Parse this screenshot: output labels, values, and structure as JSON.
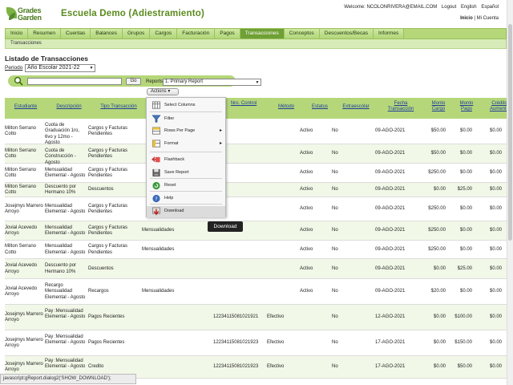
{
  "header": {
    "logo_top": "Grades",
    "logo_bottom": "Garden",
    "school": "Escuela Demo (Adiestramiento)",
    "welcome": "Welcome: NCOLONRIVERA@EMAIL.COM",
    "logout": "Logout",
    "english": "English",
    "espanol": "Español",
    "inicio": "Inicio",
    "sep": "|",
    "mi_cuenta": "Mi Cuenta"
  },
  "nav": {
    "tabs": [
      "Inicio",
      "Resumen",
      "Cuentas",
      "Balances",
      "Grupos",
      "Cargos",
      "Facturación",
      "Pagos",
      "Transacciones",
      "Conceptos",
      "Descuentos/Becas",
      "Informes"
    ],
    "active": 8,
    "sub": "Transacciones"
  },
  "page": {
    "title": "Listado de Transacciones",
    "periodo_label": "Periodo",
    "periodo_value": "Año Escolar 2021-22",
    "go": "Go",
    "reports_label": "Reports",
    "reports_value": "1. Primary Report",
    "actions": "Actions"
  },
  "table": {
    "headers": [
      "Estudiante",
      "Descripción",
      "Tipo Transacción",
      "Nro. Control",
      "Método",
      "Estatus",
      "Extraescolar",
      "Fecha Transacción",
      "Monto Cargo",
      "Monto Pago",
      "Crédito Aumento"
    ],
    "rows": [
      {
        "est": "Milton Serrano Cotto",
        "desc": "Cuota de Graduación 1ro, 6vo y 12mo - Agosto",
        "tipo": "Cargos y Facturas Pendientes",
        "cat": "",
        "ctrl": "",
        "met": "",
        "estat": "Activo",
        "extra": "No",
        "fecha": "09-AGO-2021",
        "cargo": "$50.00",
        "pago": "$0.00",
        "cred": "$0.00"
      },
      {
        "est": "Milton Serrano Cotto",
        "desc": "Cuota de Construcción - Agosto",
        "tipo": "Cargos y Facturas Pendientes",
        "cat": "",
        "ctrl": "",
        "met": "",
        "estat": "Activo",
        "extra": "No",
        "fecha": "09-AGO-2021",
        "cargo": "$50.00",
        "pago": "$0.00",
        "cred": "$0.00"
      },
      {
        "est": "Milton Serrano Cotto",
        "desc": "Mensualidad Elemental - Agosto",
        "tipo": "Cargos y Facturas Pendientes",
        "cat": "",
        "ctrl": "",
        "met": "",
        "estat": "Activo",
        "extra": "No",
        "fecha": "09-AGO-2021",
        "cargo": "$250.00",
        "pago": "$0.00",
        "cred": "$0.00"
      },
      {
        "est": "Milton Serrano Cotto",
        "desc": "Descuento por Hermano 10%",
        "tipo": "Descuentos",
        "cat": "",
        "ctrl": "",
        "met": "",
        "estat": "Activo",
        "extra": "No",
        "fecha": "09-AGO-2021",
        "cargo": "$0.00",
        "pago": "$25.00",
        "cred": "$0.00"
      },
      {
        "est": "Josejmys Marrero Arroyo",
        "desc": "Mensualidad Elemental - Agosto",
        "tipo": "Cargos y Facturas Pendientes",
        "cat": "",
        "ctrl": "",
        "met": "",
        "estat": "Activo",
        "extra": "No",
        "fecha": "09-AGO-2021",
        "cargo": "$250.00",
        "pago": "$0.00",
        "cred": "$0.00"
      },
      {
        "est": "Jovial Acevedo Arroyo",
        "desc": "Mensualidad Elemental - Agosto",
        "tipo": "Cargos y Facturas Pendientes",
        "cat": "Mensualidades",
        "ctrl": "",
        "met": "",
        "estat": "Activo",
        "extra": "No",
        "fecha": "09-AGO-2021",
        "cargo": "$250.00",
        "pago": "$0.00",
        "cred": "$0.00"
      },
      {
        "est": "Milton Serrano Cotto",
        "desc": "Mensualidad Elemental - Agosto",
        "tipo": "Cargos y Facturas Pendientes",
        "cat": "Mensualidades",
        "ctrl": "",
        "met": "",
        "estat": "Activo",
        "extra": "No",
        "fecha": "09-AGO-2021",
        "cargo": "$250.00",
        "pago": "$0.00",
        "cred": "$0.00"
      },
      {
        "est": "Jovial Acevedo Arroyo",
        "desc": "Descuento por Hermano 10%",
        "tipo": "Descuentos",
        "cat": "",
        "ctrl": "",
        "met": "",
        "estat": "Activo",
        "extra": "No",
        "fecha": "09-AGO-2021",
        "cargo": "$0.00",
        "pago": "$25.00",
        "cred": "$0.00"
      },
      {
        "est": "Jovial Acevedo Arroyo",
        "desc": "Recargo Mensualidad Elemental - Agosto",
        "tipo": "Recargos",
        "cat": "Mensualidades",
        "ctrl": "",
        "met": "",
        "estat": "Activo",
        "extra": "No",
        "fecha": "09-AGO-2021",
        "cargo": "$20.00",
        "pago": "$0.00",
        "cred": "$0.00"
      },
      {
        "est": "Josejmys Marrero Arroyo",
        "desc": "Pay :Mensualidad Elemental - Agosto",
        "tipo": "Pagos Recientes",
        "cat": "",
        "ctrl": "12234115081021921",
        "met": "Efectivo",
        "estat": "",
        "extra": "No",
        "fecha": "12-AGO-2021",
        "cargo": "$0.00",
        "pago": "$100.00",
        "cred": "$0.00"
      },
      {
        "est": "Josejmys Marrero Arroyo",
        "desc": "Pay :Mensualidad Elemental - Agosto",
        "tipo": "Pagos Recientes",
        "cat": "",
        "ctrl": "12234115081021923",
        "met": "Efectivo",
        "estat": "",
        "extra": "No",
        "fecha": "17-AGO-2021",
        "cargo": "$0.00",
        "pago": "$150.00",
        "cred": "$0.00"
      },
      {
        "est": "Josejmys Marrero Arroyo",
        "desc": "Pay :Mensualidad Elemental - Agosto",
        "tipo": "Credito",
        "cat": "",
        "ctrl": "12234115081021923",
        "met": "Efectivo",
        "estat": "",
        "extra": "No",
        "fecha": "17-AGO-2021",
        "cargo": "$0.00",
        "pago": "$50.00",
        "cred": "$0.00"
      }
    ]
  },
  "menu": {
    "items": [
      "Select Columns",
      "Filter",
      "Rows Per Page",
      "Format",
      "Flashback",
      "Save Report",
      "Reset",
      "Help",
      "Download"
    ],
    "tooltip": "Download"
  },
  "statusbar": "javascript:gReport.dialog2('SHOW_DOWNLOAD');",
  "colors": {
    "green_bar": "#b5d77a",
    "active_tab": "#6fa035",
    "brand": "#5a8a1e"
  }
}
